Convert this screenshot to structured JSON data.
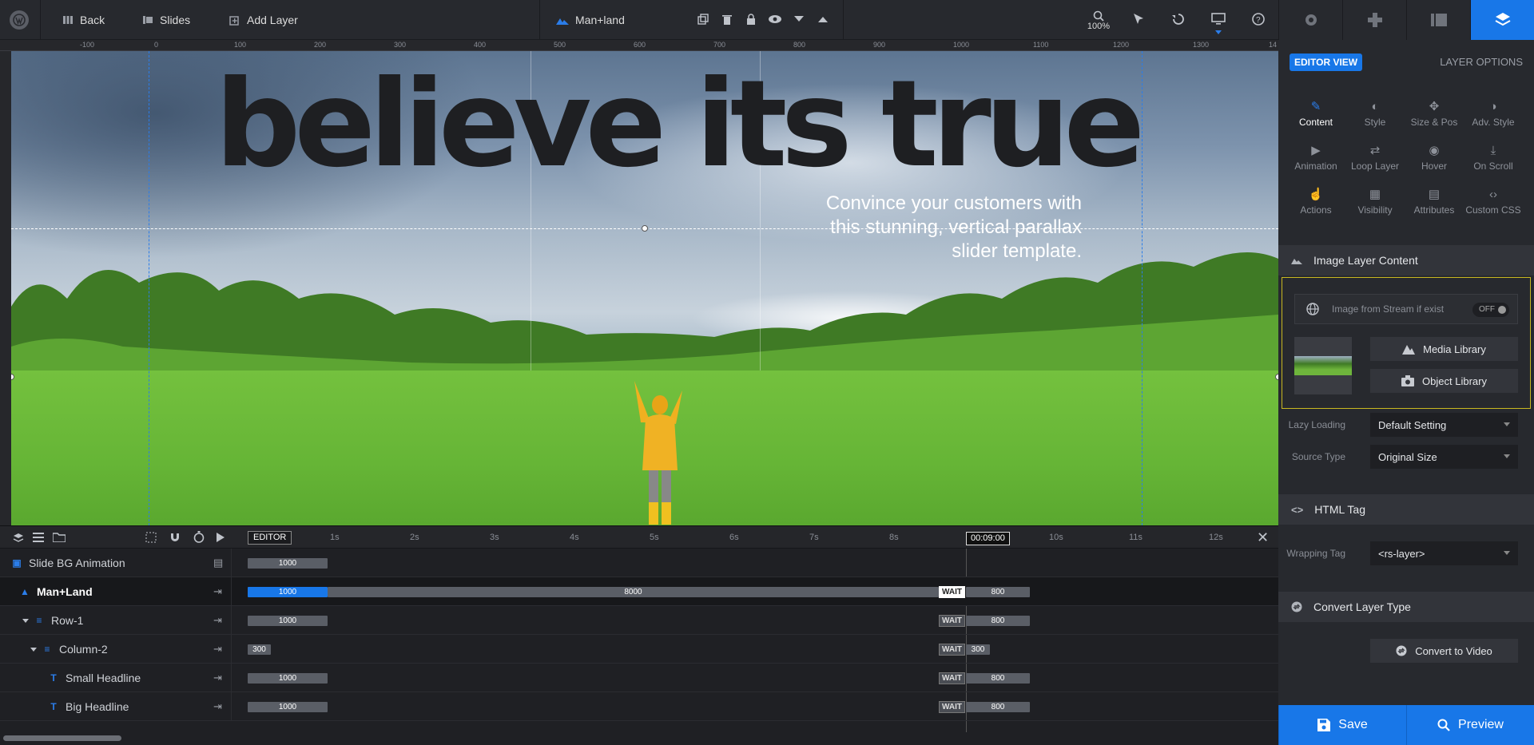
{
  "topbar": {
    "back": "Back",
    "slides": "Slides",
    "add_layer": "Add Layer",
    "layer_name": "Man+land",
    "zoom": "100%"
  },
  "ruler": [
    "-100",
    "0",
    "100",
    "200",
    "300",
    "400",
    "500",
    "600",
    "700",
    "800",
    "900",
    "1000",
    "1100",
    "1200",
    "1300",
    "14"
  ],
  "canvas": {
    "headline": "believe its true",
    "subtext_lines": [
      "Convince your customers with",
      "this stunning, vertical parallax",
      "slider template."
    ]
  },
  "timeline": {
    "editor_label": "EDITOR",
    "time_marker": "00:09:00",
    "ticks": [
      "1s",
      "2s",
      "3s",
      "4s",
      "5s",
      "6s",
      "7s",
      "8s",
      "10s",
      "11s",
      "12s"
    ],
    "rows": [
      {
        "name": "Slide BG Animation",
        "bar1": "1000"
      },
      {
        "name": "Man+Land",
        "bar1": "1000",
        "bar2": "8000",
        "wait": "WAIT",
        "end": "800"
      },
      {
        "name": "Row-1",
        "bar1": "1000",
        "wait": "WAIT",
        "end": "800"
      },
      {
        "name": "Column-2",
        "bar1": "300",
        "wait": "WAIT",
        "end": "300"
      },
      {
        "name": "Small Headline",
        "bar1": "1000",
        "wait": "WAIT",
        "end": "800"
      },
      {
        "name": "Big Headline",
        "bar1": "1000",
        "wait": "WAIT",
        "end": "800"
      }
    ]
  },
  "panel": {
    "editor_view": "EDITOR VIEW",
    "layer_options": "LAYER OPTIONS",
    "buttons": [
      "Content",
      "Style",
      "Size & Pos",
      "Adv. Style",
      "Animation",
      "Loop Layer",
      "Hover",
      "On Scroll",
      "Actions",
      "Visibility",
      "Attributes",
      "Custom CSS"
    ],
    "image_section": "Image Layer Content",
    "stream_label": "Image from Stream if exist",
    "stream_toggle": "OFF",
    "media_library": "Media Library",
    "object_library": "Object Library",
    "lazy_label": "Lazy Loading",
    "lazy_value": "Default Setting",
    "source_label": "Source Type",
    "source_value": "Original Size",
    "html_section": "HTML Tag",
    "wrap_label": "Wrapping Tag",
    "wrap_value": "<rs-layer>",
    "convert_section": "Convert Layer Type",
    "convert_button": "Convert to Video",
    "save": "Save",
    "preview": "Preview"
  },
  "colors": {
    "accent": "#1877e8",
    "selection": "#c9b820"
  }
}
